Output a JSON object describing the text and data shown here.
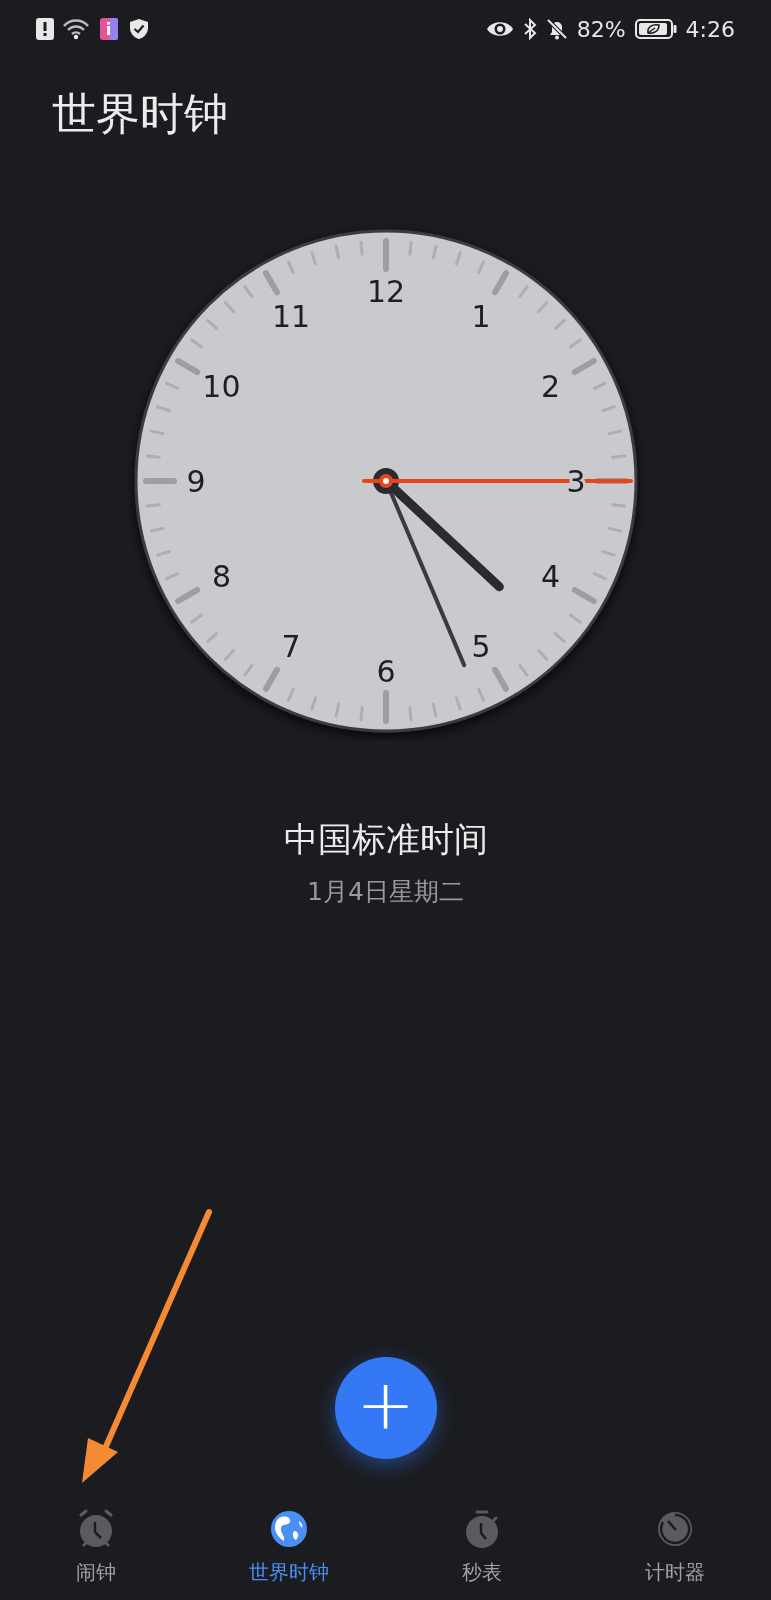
{
  "status_bar": {
    "battery": "82%",
    "time": "4:26"
  },
  "title": "世界时钟",
  "clock": {
    "numerals": [
      "12",
      "1",
      "2",
      "3",
      "4",
      "5",
      "6",
      "7",
      "8",
      "9",
      "10",
      "11"
    ]
  },
  "city": {
    "name": "中国标准时间",
    "date": "1月4日星期二"
  },
  "add_button": {
    "label": "+"
  },
  "tabs": [
    {
      "label": "闹钟",
      "selected": false
    },
    {
      "label": "世界时钟",
      "selected": true
    },
    {
      "label": "秒表",
      "selected": false
    },
    {
      "label": "计时器",
      "selected": false
    }
  ],
  "annotations": [
    {
      "kind": "arrow"
    }
  ]
}
